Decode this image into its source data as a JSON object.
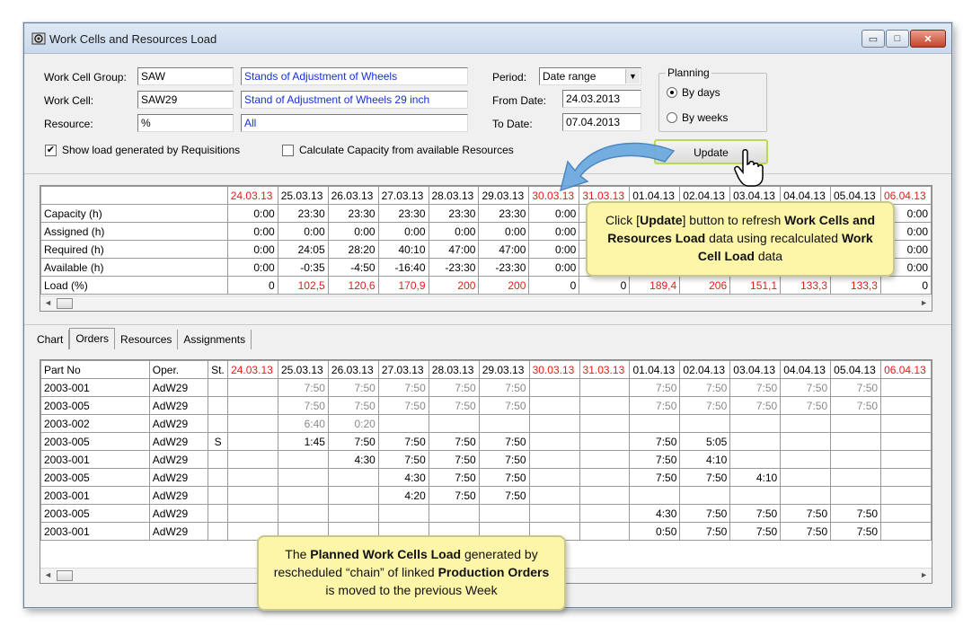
{
  "window": {
    "title": "Work Cells and Resources Load",
    "minimize_glyph": "▭",
    "maximize_glyph": "□",
    "close_glyph": "✕"
  },
  "form": {
    "work_cell_group_label": "Work Cell Group:",
    "work_cell_group_value": "SAW",
    "work_cell_group_desc": "Stands of Adjustment of Wheels",
    "work_cell_label": "Work Cell:",
    "work_cell_value": "SAW29",
    "work_cell_desc": "Stand of Adjustment of Wheels 29 inch",
    "resource_label": "Resource:",
    "resource_value": "%",
    "resource_desc": "All",
    "show_load_label": "Show load generated by Requisitions",
    "show_load_checked": true,
    "calc_capacity_label": "Calculate Capacity from available Resources",
    "calc_capacity_checked": false,
    "check_mark": "✔",
    "period_label": "Period:",
    "period_value": "Date range",
    "combo_arrow": "▼",
    "from_date_label": "From Date:",
    "from_date_value": "24.03.2013",
    "to_date_label": "To Date:",
    "to_date_value": "07.04.2013",
    "planning_label": "Planning",
    "by_days_label": "By days",
    "by_weeks_label": "By weeks",
    "update_label": "Update"
  },
  "colors": {
    "weekend": "#e81b1b",
    "callout_bg": "#fdf5a8",
    "arrow": "#6aa9e0"
  },
  "load_grid": {
    "dates": [
      "24.03.13",
      "25.03.13",
      "26.03.13",
      "27.03.13",
      "28.03.13",
      "29.03.13",
      "30.03.13",
      "31.03.13",
      "01.04.13",
      "02.04.13",
      "03.04.13",
      "04.04.13",
      "05.04.13",
      "06.04.13"
    ],
    "date_cols_shown": [
      "24.03.13",
      "25.03.13",
      "26.03.13",
      "27.03.13",
      "28.03.13",
      "29.03.13",
      "30.03.13",
      "31.03.13",
      "01.04.13",
      "02.04.13",
      "03.04.13",
      "04.04.13",
      "05.04.13",
      "06.04.13"
    ],
    "weekend_flags": [
      true,
      false,
      false,
      false,
      false,
      false,
      true,
      true,
      false,
      false,
      false,
      false,
      false,
      true
    ],
    "rows": [
      {
        "label": "Capacity (h)",
        "values": [
          "0:00",
          "23:30",
          "23:30",
          "23:30",
          "23:30",
          "23:30",
          "0:00",
          "",
          "",
          "",
          "",
          "",
          "",
          "0:00"
        ]
      },
      {
        "label": "Assigned (h)",
        "values": [
          "0:00",
          "0:00",
          "0:00",
          "0:00",
          "0:00",
          "0:00",
          "0:00",
          "",
          "",
          "",
          "",
          "",
          "",
          "0:00"
        ]
      },
      {
        "label": "Required (h)",
        "values": [
          "0:00",
          "24:05",
          "28:20",
          "40:10",
          "47:00",
          "47:00",
          "0:00",
          "",
          "",
          "",
          "",
          "",
          "",
          "0:00"
        ]
      },
      {
        "label": "Available (h)",
        "values": [
          "0:00",
          "-0:35",
          "-4:50",
          "-16:40",
          "-23:30",
          "-23:30",
          "0:00",
          "",
          "",
          "",
          "",
          "",
          "",
          "0:00"
        ]
      },
      {
        "label": "Load (%)",
        "values": [
          "0",
          "102,5",
          "120,6",
          "170,9",
          "200",
          "200",
          "0",
          "0",
          "189,4",
          "206",
          "151,1",
          "133,3",
          "133,3",
          "0"
        ],
        "red": [
          false,
          true,
          true,
          true,
          true,
          true,
          false,
          false,
          true,
          true,
          true,
          true,
          true,
          false
        ]
      }
    ]
  },
  "tabs": [
    "Chart",
    "Orders",
    "Resources",
    "Assignments"
  ],
  "active_tab": "Orders",
  "orders_grid": {
    "headers": {
      "part_no": "Part No",
      "oper": "Oper.",
      "st": "St."
    },
    "rows": [
      {
        "part": "2003-001",
        "oper": "AdW29",
        "st": "",
        "values": [
          "",
          "7:50",
          "7:50",
          "7:50",
          "7:50",
          "7:50",
          "",
          "",
          "7:50",
          "7:50",
          "7:50",
          "7:50",
          "7:50",
          ""
        ],
        "grey": true
      },
      {
        "part": "2003-005",
        "oper": "AdW29",
        "st": "",
        "values": [
          "",
          "7:50",
          "7:50",
          "7:50",
          "7:50",
          "7:50",
          "",
          "",
          "7:50",
          "7:50",
          "7:50",
          "7:50",
          "7:50",
          ""
        ],
        "grey": true
      },
      {
        "part": "2003-002",
        "oper": "AdW29",
        "st": "",
        "values": [
          "",
          "6:40",
          "0:20",
          "",
          "",
          "",
          "",
          "",
          "",
          "",
          "",
          "",
          "",
          ""
        ],
        "grey": true
      },
      {
        "part": "2003-005",
        "oper": "AdW29",
        "st": "S",
        "values": [
          "",
          "1:45",
          "7:50",
          "7:50",
          "7:50",
          "7:50",
          "",
          "",
          "7:50",
          "5:05",
          "",
          "",
          "",
          ""
        ],
        "grey": false
      },
      {
        "part": "2003-001",
        "oper": "AdW29",
        "st": "",
        "values": [
          "",
          "",
          "4:30",
          "7:50",
          "7:50",
          "7:50",
          "",
          "",
          "7:50",
          "4:10",
          "",
          "",
          "",
          ""
        ],
        "grey": false
      },
      {
        "part": "2003-005",
        "oper": "AdW29",
        "st": "",
        "values": [
          "",
          "",
          "",
          "4:30",
          "7:50",
          "7:50",
          "",
          "",
          "7:50",
          "7:50",
          "4:10",
          "",
          "",
          ""
        ],
        "grey": false
      },
      {
        "part": "2003-001",
        "oper": "AdW29",
        "st": "",
        "values": [
          "",
          "",
          "",
          "4:20",
          "7:50",
          "7:50",
          "",
          "",
          "",
          "",
          "",
          "",
          "",
          ""
        ],
        "grey": false
      },
      {
        "part": "2003-005",
        "oper": "AdW29",
        "st": "",
        "values": [
          "",
          "",
          "",
          "",
          "",
          "",
          "",
          "",
          "4:30",
          "7:50",
          "7:50",
          "7:50",
          "7:50",
          ""
        ],
        "grey": false
      },
      {
        "part": "2003-001",
        "oper": "AdW29",
        "st": "",
        "values": [
          "",
          "",
          "",
          "",
          "",
          "",
          "",
          "",
          "0:50",
          "7:50",
          "7:50",
          "7:50",
          "7:50",
          ""
        ],
        "grey": false
      }
    ]
  },
  "scroll": {
    "left": "◄",
    "right": "►"
  },
  "callout_update": {
    "pre": "Click [",
    "b1": "Update",
    "mid1": "] button to refresh ",
    "b2": "Work Cells and Resources Load",
    "mid2": " data using recalculated ",
    "b3": "Work Cell Load",
    "post": " data"
  },
  "callout_orders": {
    "pre": "The ",
    "b1": "Planned Work Cells Load",
    "mid1": " generated by rescheduled “chain” of linked ",
    "b2": "Production Orders",
    "post": " is moved to the previous Week"
  }
}
